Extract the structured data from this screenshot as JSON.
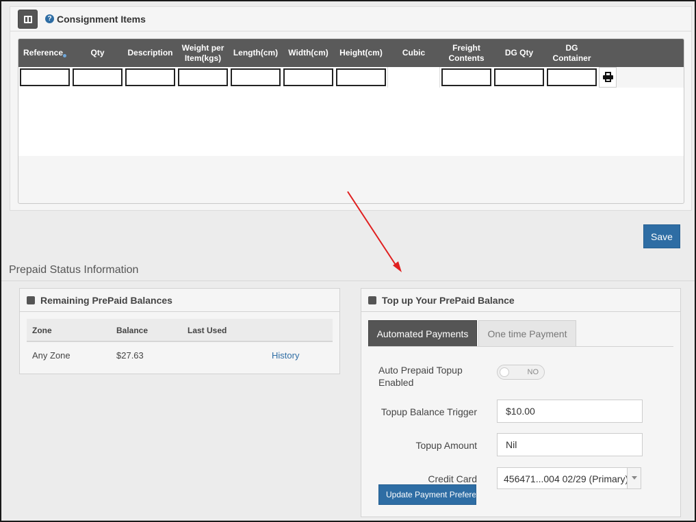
{
  "consignment": {
    "title": "Consignment Items",
    "columns": [
      "Reference",
      "Qty",
      "Description",
      "Weight per Item(kgs)",
      "Length(cm)",
      "Width(cm)",
      "Height(cm)",
      "Cubic",
      "Freight Contents",
      "DG Qty",
      "DG Container"
    ]
  },
  "save_label": "Save",
  "prepaid": {
    "section_title": "Prepaid Status Information",
    "balances": {
      "title": "Remaining PrePaid Balances",
      "headers": [
        "Zone",
        "Balance",
        "Last Used"
      ],
      "rows": [
        {
          "zone": "Any Zone",
          "balance": "$27.63",
          "last_used": "",
          "link": "History"
        }
      ]
    },
    "topup": {
      "title": "Top up Your PrePaid Balance",
      "tabs": [
        "Automated Payments",
        "One time Payment"
      ],
      "auto_label": "Auto Prepaid Topup Enabled",
      "switch_text": "NO",
      "trigger_label": "Topup Balance Trigger",
      "trigger_value": "$10.00",
      "amount_label": "Topup Amount",
      "amount_value": "Nil",
      "card_label": "Credit Card",
      "card_value": "456471...004 02/29 (Primary)",
      "update_button": "Update Payment Preferences"
    }
  },
  "colors": {
    "accent": "#2e6da4",
    "header_dark": "#5a5a5a",
    "annotation_arrow": "#e02020"
  }
}
